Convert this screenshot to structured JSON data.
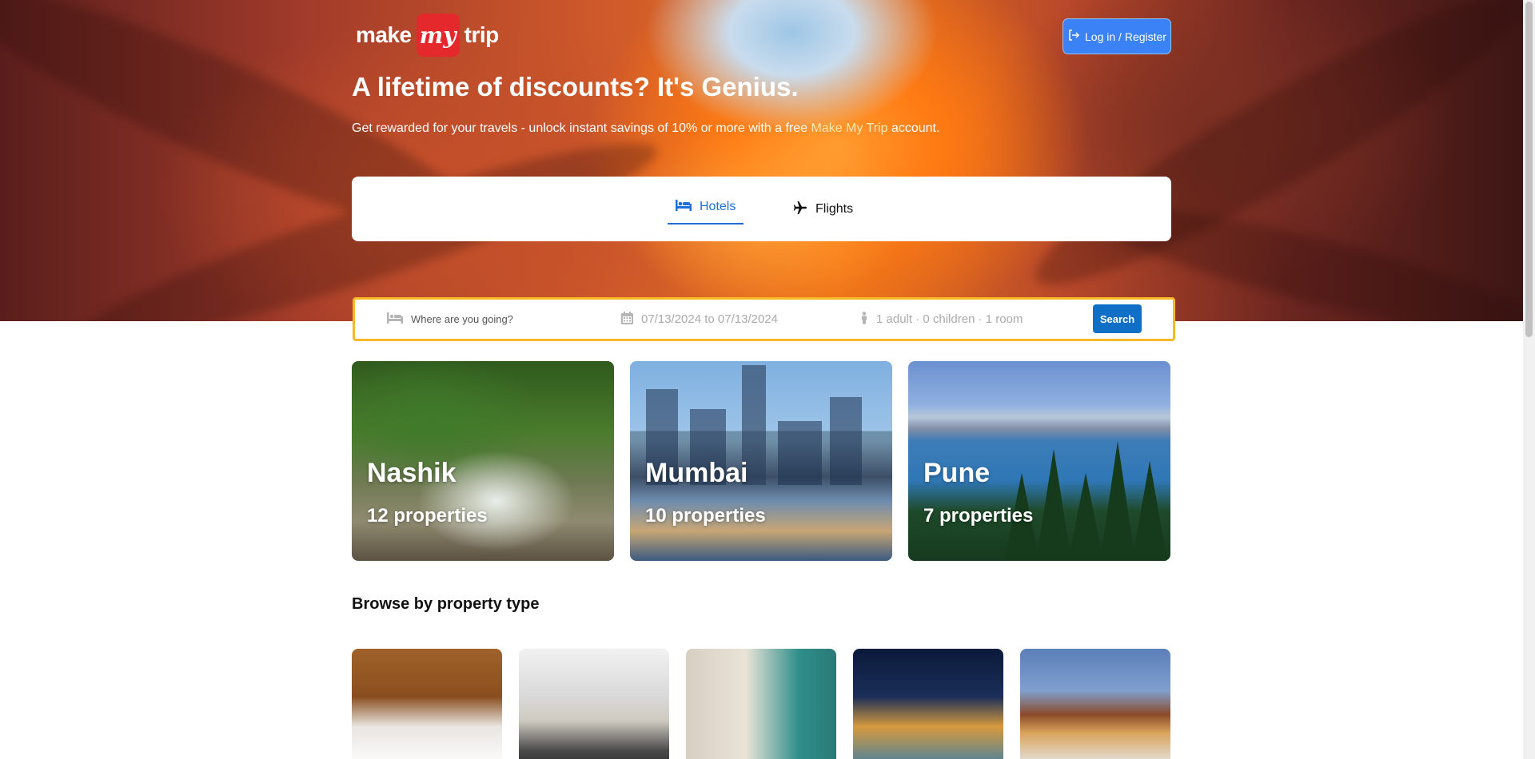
{
  "header": {
    "logo_make": "make",
    "logo_my": "my",
    "logo_trip": "trip",
    "login_label": "Log in / Register"
  },
  "hero": {
    "headline": "A lifetime of discounts? It's Genius.",
    "sub_before": "Get rewarded for your travels - unlock instant savings of 10% or more with a free ",
    "sub_brand": "Make My Trip",
    "sub_after": " account."
  },
  "tabs": [
    {
      "label": "Hotels",
      "icon": "bed-icon",
      "active": true
    },
    {
      "label": "Flights",
      "icon": "plane-icon",
      "active": false
    }
  ],
  "search": {
    "destination_placeholder": "Where are you going?",
    "dates_placeholder": "07/13/2024 to 07/13/2024",
    "guests_placeholder": "1 adult · 0 children · 1 room",
    "search_label": "Search"
  },
  "cities": [
    {
      "name": "Nashik",
      "properties": "12 properties"
    },
    {
      "name": "Mumbai",
      "properties": "10 properties"
    },
    {
      "name": "Pune",
      "properties": "7 properties"
    }
  ],
  "browse": {
    "title": "Browse by property type"
  },
  "colors": {
    "accent_blue": "#1e6fd9",
    "search_button": "#0f6fc6",
    "search_border": "#f7b924",
    "login_button": "#3b82f6",
    "logo_red": "#e5282b"
  }
}
